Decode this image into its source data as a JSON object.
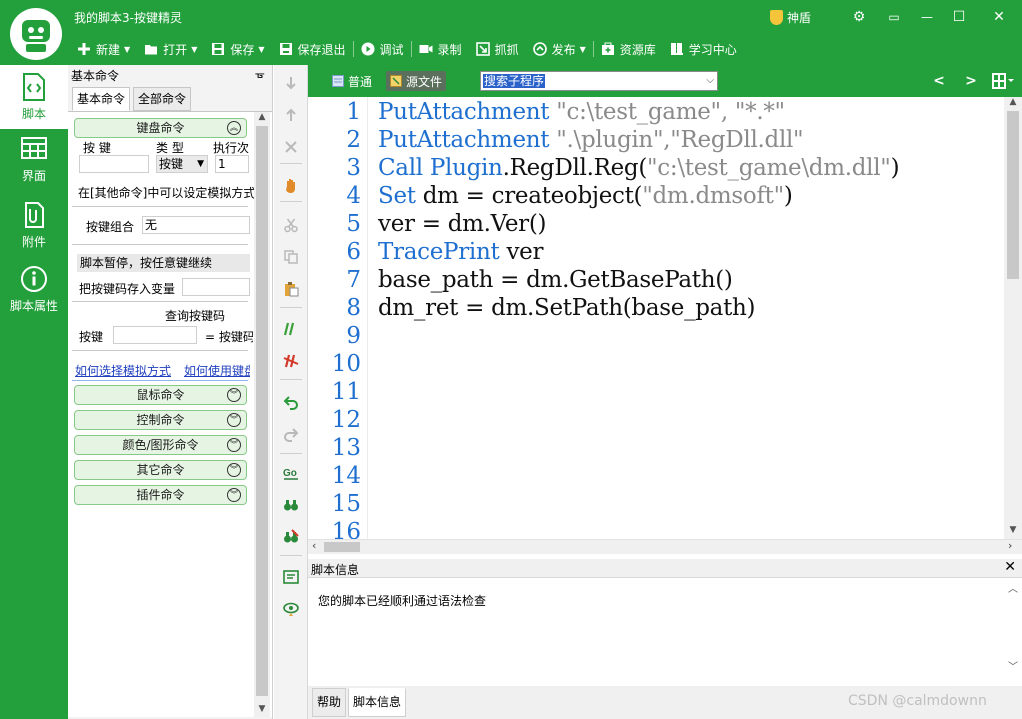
{
  "window": {
    "title": "我的脚本3-按键精灵",
    "shield_label": "神盾",
    "controls": {
      "settings": "⚙",
      "menu": "▭",
      "minimize": "—",
      "maximize": "☐",
      "close": "✕"
    }
  },
  "toolbar": {
    "new_label": "新建",
    "open_label": "打开",
    "save_label": "保存",
    "save_exit_label": "保存退出",
    "debug_label": "调试",
    "record_label": "录制",
    "capture_label": "抓抓",
    "publish_label": "发布",
    "resources_label": "资源库",
    "learning_label": "学习中心"
  },
  "leftnav": {
    "items": [
      {
        "label": "脚本",
        "icon": "script-file-icon",
        "active": true
      },
      {
        "label": "界面",
        "icon": "layout-grid-icon",
        "active": false
      },
      {
        "label": "附件",
        "icon": "attachment-icon",
        "active": false
      },
      {
        "label": "脚本属性",
        "icon": "info-icon",
        "active": false
      }
    ]
  },
  "cmdpanel": {
    "title": "基本命令",
    "pin": "ᚗ",
    "tabs": [
      "基本命令",
      "全部命令"
    ],
    "keyboard_group": "键盘命令",
    "col_key": "按 键",
    "col_type": "类 型",
    "col_exec": "执行次",
    "type_value": "按键",
    "exec_value": "1",
    "hint": "在[其他命令]中可以设定模拟方式",
    "combo_label": "按键组合",
    "combo_value": "无",
    "pause_label": "脚本暂停，按任意键继续",
    "store_label": "把按键码存入变量",
    "query_label": "查询按键码",
    "key_label": "按键",
    "keycode_label": "= 按键码",
    "link_mode": "如何选择模拟方式",
    "link_use": "如何使用键盘",
    "groups": [
      "鼠标命令",
      "控制命令",
      "颜色/图形命令",
      "其它命令",
      "插件命令"
    ]
  },
  "editor": {
    "mode_normal": "普通",
    "mode_source": "源文件",
    "search_placeholder": "搜索子程序",
    "line_numbers": [
      "1",
      "2",
      "3",
      "4",
      "5",
      "6",
      "7",
      "8",
      "9",
      "10",
      "11",
      "12",
      "13",
      "14",
      "15",
      "16"
    ],
    "code_lines": [
      [
        {
          "t": "PutAttachment ",
          "c": "kw"
        },
        {
          "t": "\"c:\\test_game\", \"*.*\"",
          "c": "str"
        }
      ],
      [
        {
          "t": "PutAttachment ",
          "c": "kw"
        },
        {
          "t": "\".\\plugin\",\"RegDll.dll\"",
          "c": "str"
        }
      ],
      [
        {
          "t": "Call Plugin",
          "c": "kw"
        },
        {
          "t": ".RegDll.Reg(",
          "c": ""
        },
        {
          "t": "\"c:\\test_game\\dm.dll\"",
          "c": "str"
        },
        {
          "t": ")",
          "c": ""
        }
      ],
      [
        {
          "t": "Set ",
          "c": "kw"
        },
        {
          "t": "dm = createobject(",
          "c": ""
        },
        {
          "t": "\"dm.dmsoft\"",
          "c": "str"
        },
        {
          "t": ")",
          "c": ""
        }
      ],
      [
        {
          "t": "ver = dm.Ver()",
          "c": ""
        }
      ],
      [
        {
          "t": "TracePrint ",
          "c": "kw"
        },
        {
          "t": "ver",
          "c": ""
        }
      ],
      [
        {
          "t": "base_path = dm.GetBasePath()",
          "c": ""
        }
      ],
      [
        {
          "t": "dm_ret = dm.SetPath(base_path)",
          "c": ""
        }
      ]
    ]
  },
  "info": {
    "title": "脚本信息",
    "close": "✕",
    "message": "您的脚本已经顺利通过语法检查",
    "tabs": [
      "帮助",
      "脚本信息"
    ]
  },
  "watermark": "CSDN @calmdownn",
  "colors": {
    "brand_green": "#23a03c",
    "keyword_blue": "#1e6fd0",
    "string_gray": "#8a8a8a"
  }
}
